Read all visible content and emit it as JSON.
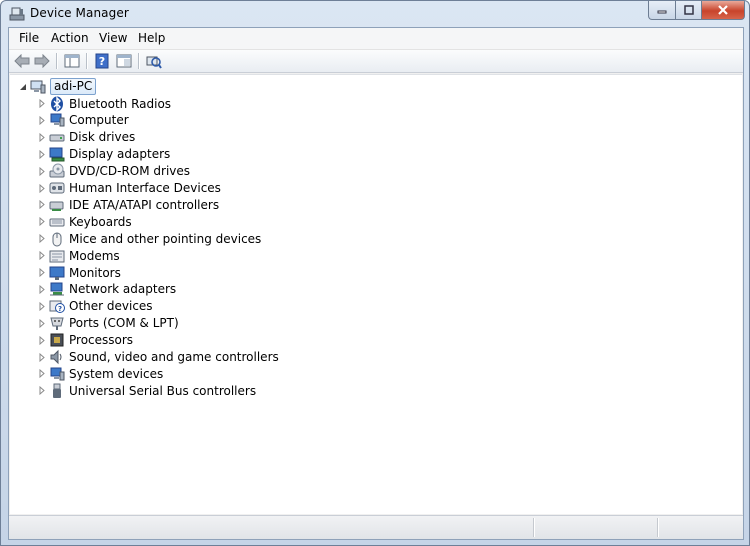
{
  "window": {
    "title": "Device Manager"
  },
  "menu": [
    "File",
    "Action",
    "View",
    "Help"
  ],
  "tree": {
    "root": "adi-PC",
    "categories": [
      "Bluetooth Radios",
      "Computer",
      "Disk drives",
      "Display adapters",
      "DVD/CD-ROM drives",
      "Human Interface Devices",
      "IDE ATA/ATAPI controllers",
      "Keyboards",
      "Mice and other pointing devices",
      "Modems",
      "Monitors",
      "Network adapters",
      "Other devices",
      "Ports (COM & LPT)",
      "Processors",
      "Sound, video and game controllers",
      "System devices",
      "Universal Serial Bus controllers"
    ],
    "icons": [
      "bluetooth-icon",
      "computer-icon",
      "disk-drive-icon",
      "display-adapter-icon",
      "dvd-drive-icon",
      "hid-icon",
      "ide-controller-icon",
      "keyboard-icon",
      "mouse-icon",
      "modem-icon",
      "monitor-icon",
      "network-adapter-icon",
      "other-devices-icon",
      "port-icon",
      "processor-icon",
      "sound-icon",
      "system-devices-icon",
      "usb-icon"
    ]
  },
  "colors": {
    "titlebar": "#c5d4e7",
    "close_button": "#c8442b",
    "selection": "#dbeaf9"
  }
}
